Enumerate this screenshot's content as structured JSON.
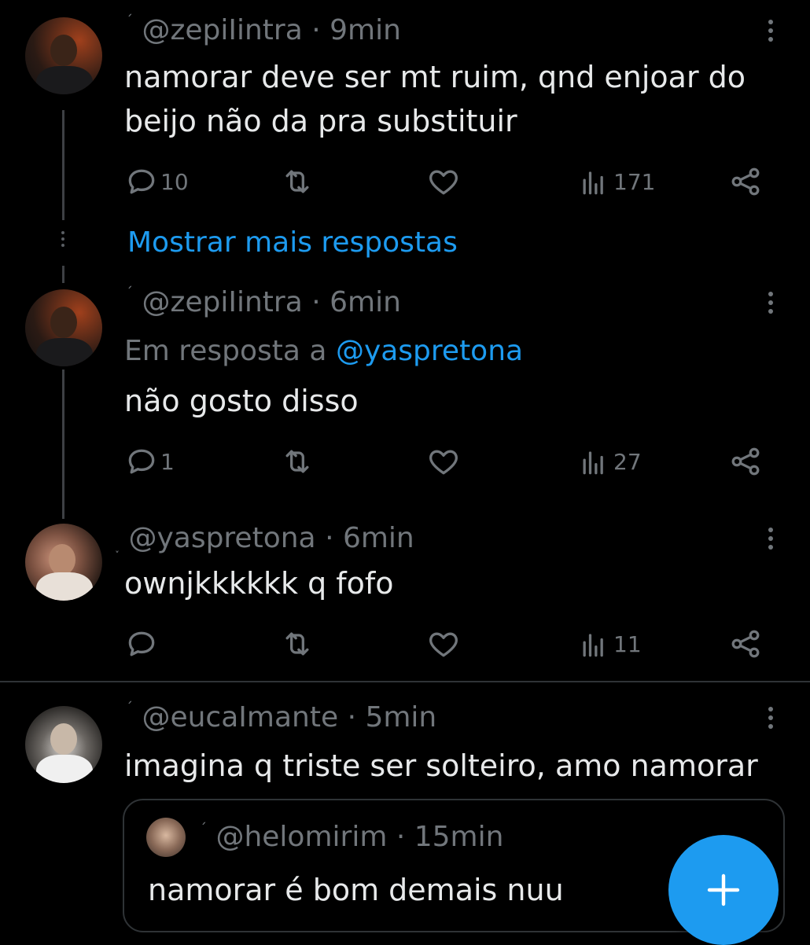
{
  "tweets": [
    {
      "prefix_glyph": "´",
      "handle": "@zepiIintra",
      "time": "· 9min",
      "reply_to_label": "",
      "reply_to_mention": "",
      "text_lines": [
        "namorar deve ser mt ruim, qnd enjoar do",
        "beijo não da pra substituir"
      ],
      "replies": "10",
      "retweets": "",
      "likes": "",
      "views": "171"
    },
    {
      "prefix_glyph": "´",
      "handle": "@zepiIintra",
      "time": "· 6min",
      "reply_to_label": "Em resposta a",
      "reply_to_mention": "@yaspretona",
      "text_lines": [
        "não gosto disso"
      ],
      "replies": "1",
      "retweets": "",
      "likes": "",
      "views": "27"
    },
    {
      "prefix_glyph": "˯",
      "handle": "@yaspretona",
      "time": "· 6min",
      "text_lines": [
        "ownjkkkkkk q fofo"
      ],
      "replies": "",
      "retweets": "",
      "likes": "",
      "views": "11"
    },
    {
      "prefix_glyph": "´",
      "handle": "@eucaImante",
      "time": "· 5min",
      "text_lines": [
        "imagina q triste ser solteiro, amo namorar"
      ]
    }
  ],
  "show_more": "Mostrar mais respostas",
  "quote": {
    "prefix_glyph": "´",
    "handle": "@helomirim",
    "time": "· 15min",
    "text": "namorar é bom demais nuu"
  },
  "colors": {
    "background": "#000000",
    "text": "#e7e9ea",
    "muted": "#71767b",
    "accent": "#1d9bf0",
    "divider": "#2f3336"
  },
  "icons": [
    "reply-icon",
    "retweet-icon",
    "like-icon",
    "views-icon",
    "share-icon",
    "more-icon",
    "compose-plus-icon"
  ]
}
